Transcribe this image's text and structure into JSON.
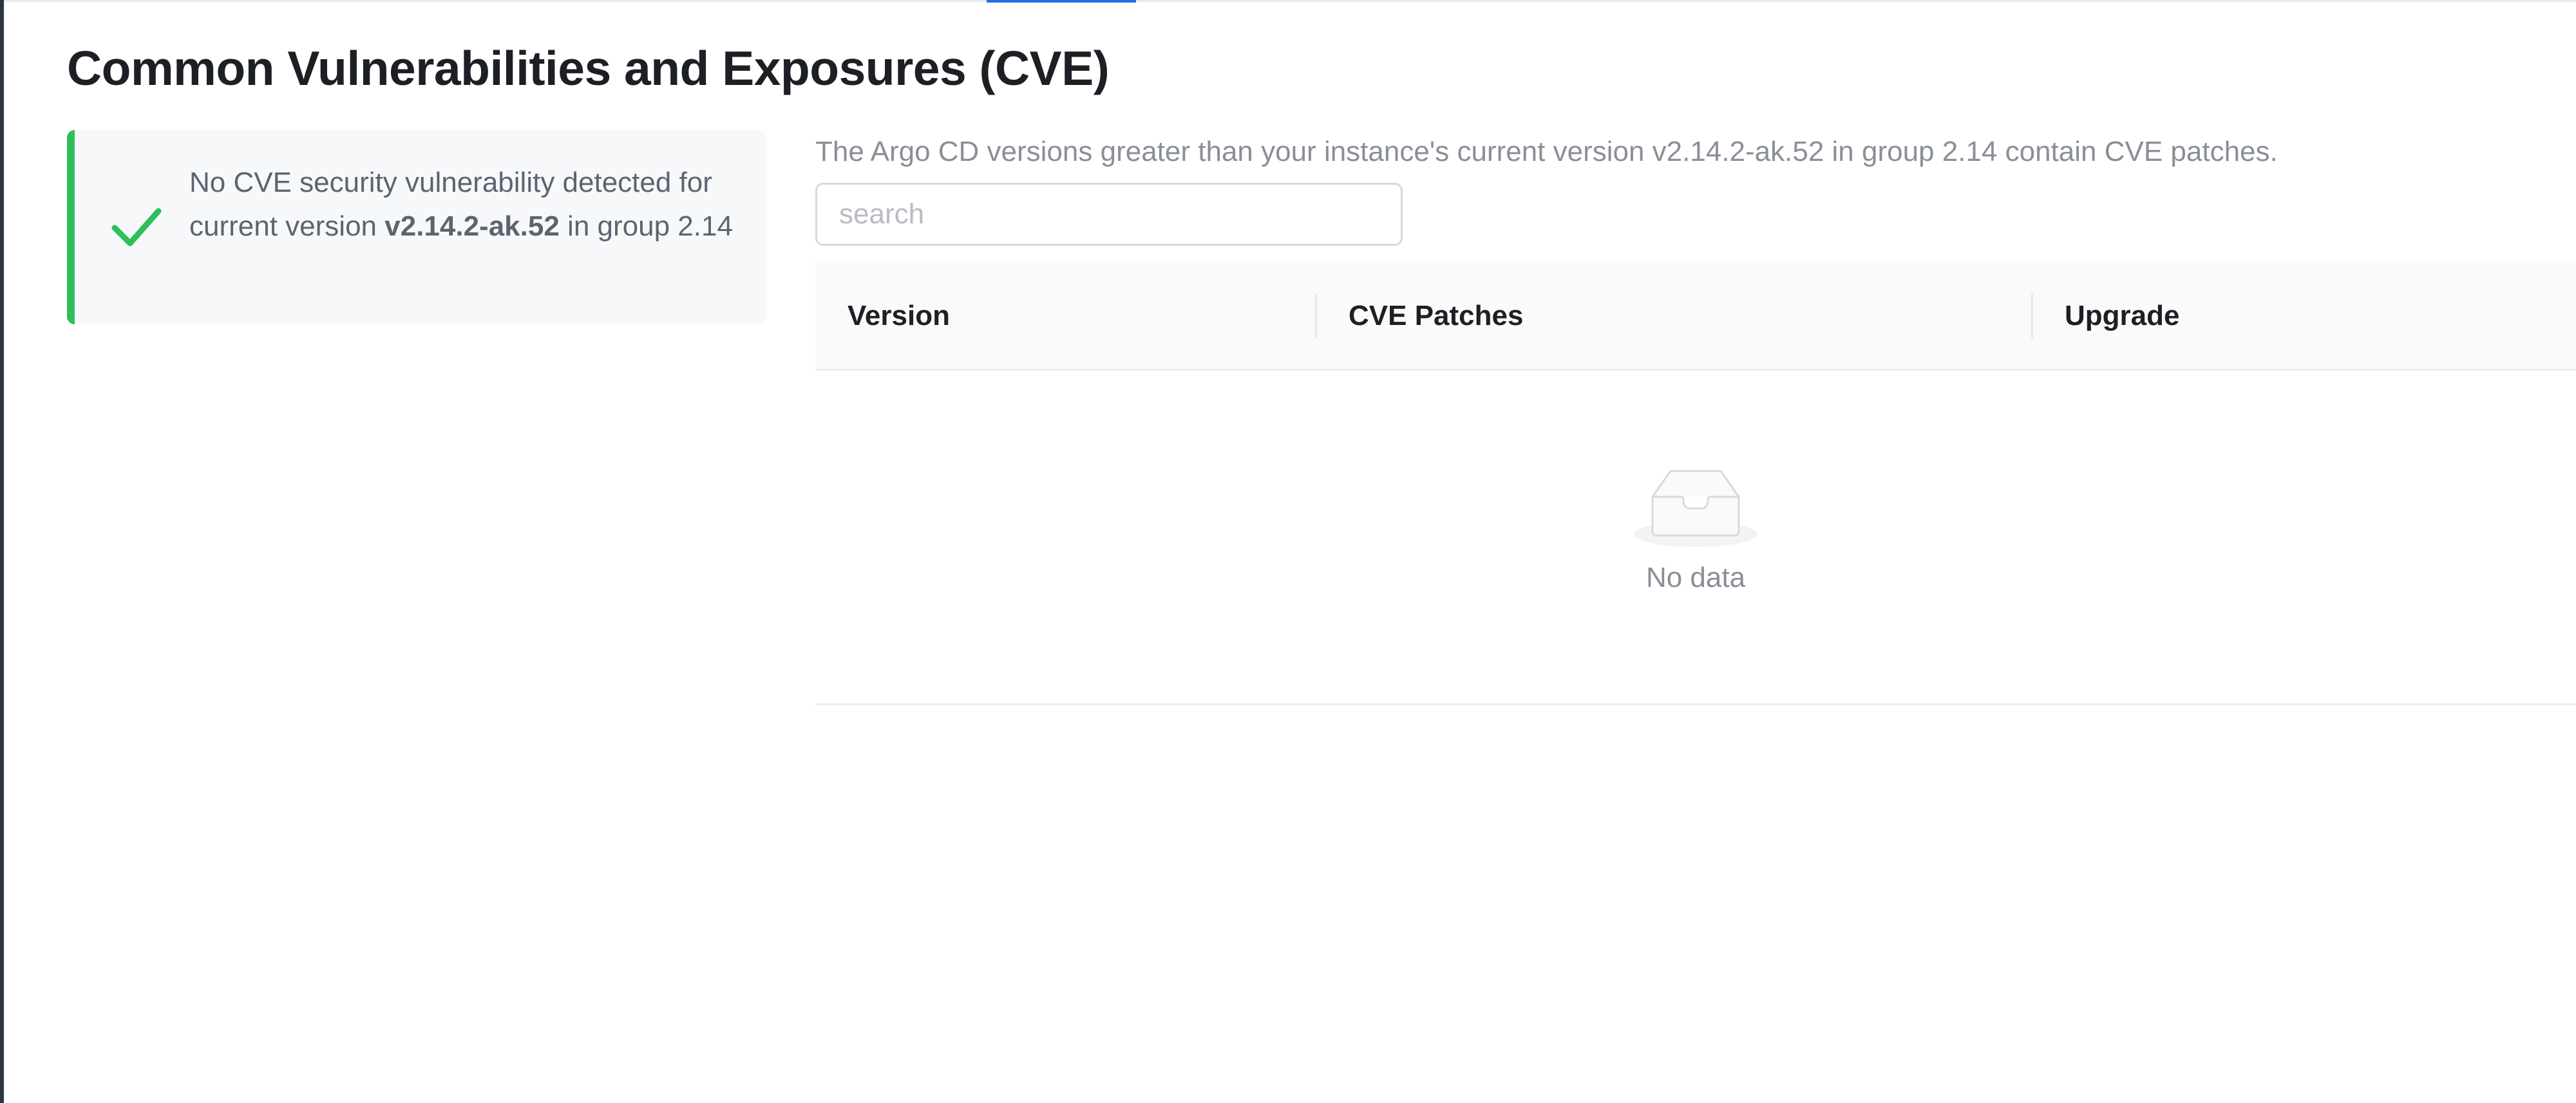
{
  "page": {
    "title": "Common Vulnerabilities and Exposures (CVE)"
  },
  "status_card": {
    "line_prefix": "No CVE security vulnerability detected for current version",
    "version": "v2.14.2-ak.52",
    "line_suffix": "in group 2.14",
    "icon": "check-icon",
    "accent_color": "#2cbf5a"
  },
  "description": "The Argo CD versions greater than your instance's current version v2.14.2-ak.52 in group 2.14 contain CVE patches.",
  "search": {
    "placeholder": "search",
    "value": ""
  },
  "table": {
    "columns": [
      "Version",
      "CVE Patches",
      "Upgrade"
    ],
    "rows": [],
    "empty_text": "No data",
    "empty_icon": "inbox-icon"
  },
  "colors": {
    "accent": "#1f6fe5",
    "success": "#2cbf5a"
  }
}
